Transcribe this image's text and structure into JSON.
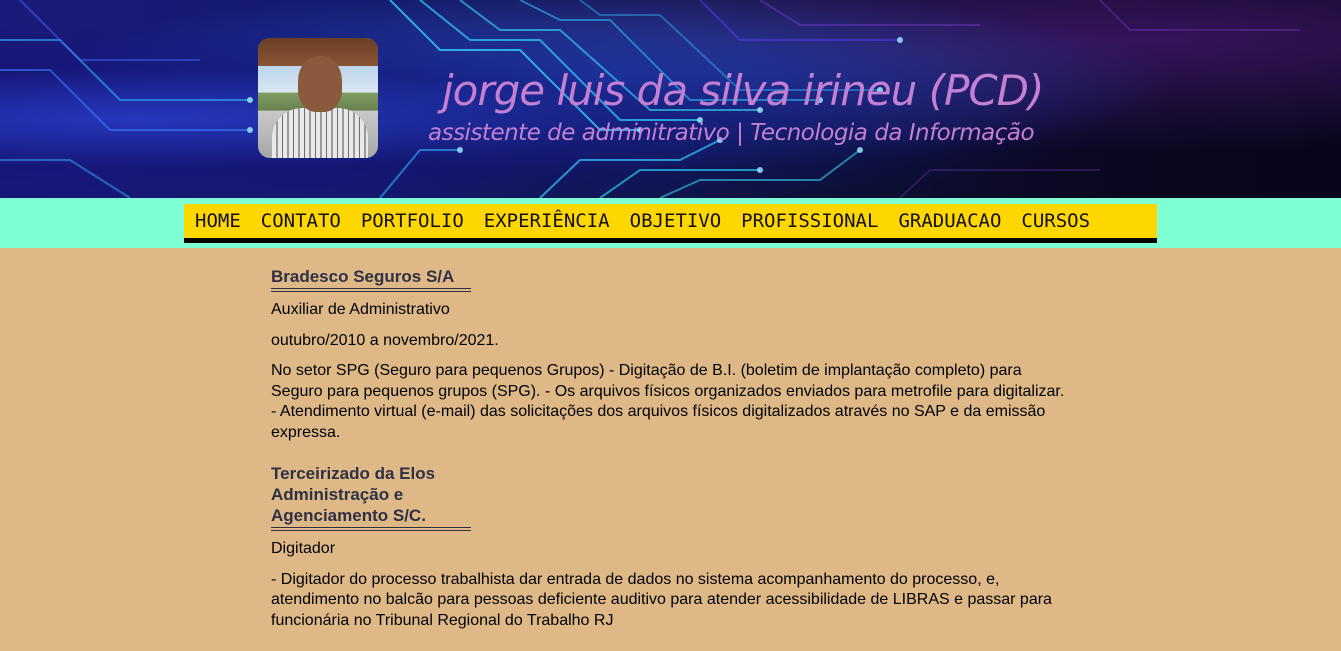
{
  "header": {
    "name": "jorge luis da silva irineu (PCD)",
    "subtitle": "assistente de adminitrativo | Tecnologia da Informação"
  },
  "nav": {
    "items": [
      "HOME",
      "CONTATO",
      "PORTFOLIO",
      "EXPERIÊNCIA",
      "OBJETIVO",
      "PROFISSIONAL",
      "GRADUACAO",
      "CURSOS"
    ]
  },
  "experience": [
    {
      "company": "Bradesco Seguros S/A",
      "role": "Auxiliar de Administrativo",
      "period": "outubro/2010 a novembro/2021.",
      "description": "No setor SPG (Seguro para pequenos Grupos) - Digitação de B.I. (boletim de implantação completo) para Seguro para pequenos grupos (SPG). - Os arquivos físicos organizados enviados para metrofile para digitalizar. - Atendimento virtual (e-mail) das solicitações dos arquivos físicos digitalizados através no SAP e da emissão expressa."
    },
    {
      "company": "Terceirizado da Elos Administração e Agenciamento S/C.",
      "role": "Digitador",
      "description": "- Digitador do processo trabalhista dar entrada de dados no sistema acompanhamento do processo, e, atendimento no balcão para pessoas deficiente auditivo para atender acessibilidade de LIBRAS e passar para funcionária no Tribunal Regional do Trabalho RJ"
    }
  ],
  "colors": {
    "page_background": "#deb887",
    "nav_band": "#7fffd4",
    "nav_bar": "#ffd700",
    "title_text": "#c37fd1",
    "company_heading": "#2e3144"
  }
}
